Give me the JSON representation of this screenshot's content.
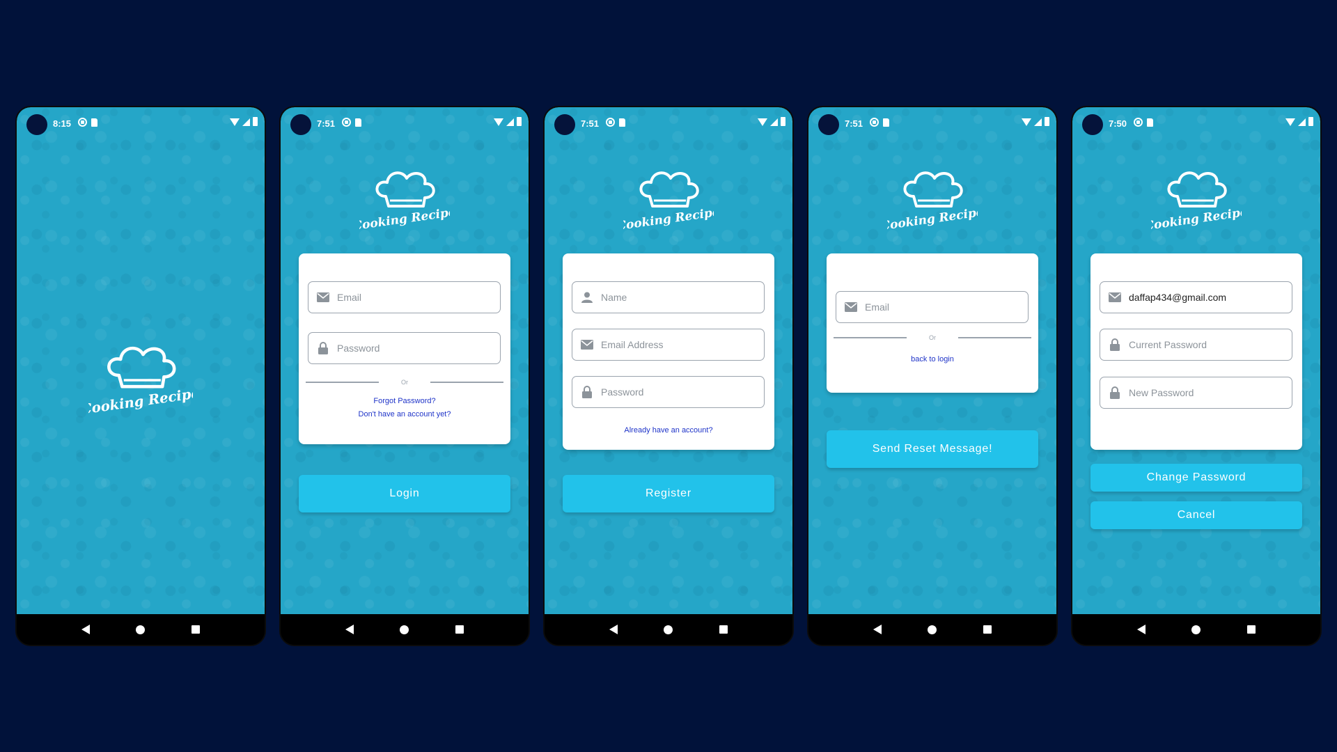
{
  "app": {
    "logo_text": "Cooking Recipe",
    "accent_color": "#22c2ea",
    "background_color": "#25a6c8",
    "link_color": "#1e33c8"
  },
  "screens": [
    {
      "id": "splash",
      "status_time": "8:15"
    },
    {
      "id": "login",
      "status_time": "7:51",
      "fields": [
        {
          "icon": "mail-icon",
          "placeholder": "Email"
        },
        {
          "icon": "lock-icon",
          "placeholder": "Password"
        }
      ],
      "divider_text": "Or",
      "links": [
        "Forgot Password?",
        "Don't have an account yet?"
      ],
      "button": "Login"
    },
    {
      "id": "register",
      "status_time": "7:51",
      "fields": [
        {
          "icon": "person-icon",
          "placeholder": "Name"
        },
        {
          "icon": "mail-icon",
          "placeholder": "Email Address"
        },
        {
          "icon": "lock-icon",
          "placeholder": "Password"
        }
      ],
      "links": [
        "Already have an account?"
      ],
      "button": "Register"
    },
    {
      "id": "forgot-password",
      "status_time": "7:51",
      "fields": [
        {
          "icon": "mail-icon",
          "placeholder": "Email"
        }
      ],
      "divider_text": "Or",
      "links": [
        "back to login"
      ],
      "button": "Send Reset Message!"
    },
    {
      "id": "change-password",
      "status_time": "7:50",
      "fields": [
        {
          "icon": "mail-icon",
          "value": "daffap434@gmail.com"
        },
        {
          "icon": "lock-icon",
          "placeholder": "Current Password"
        },
        {
          "icon": "lock-icon",
          "placeholder": "New Password"
        }
      ],
      "buttons": [
        "Change Password",
        "Cancel"
      ]
    }
  ]
}
